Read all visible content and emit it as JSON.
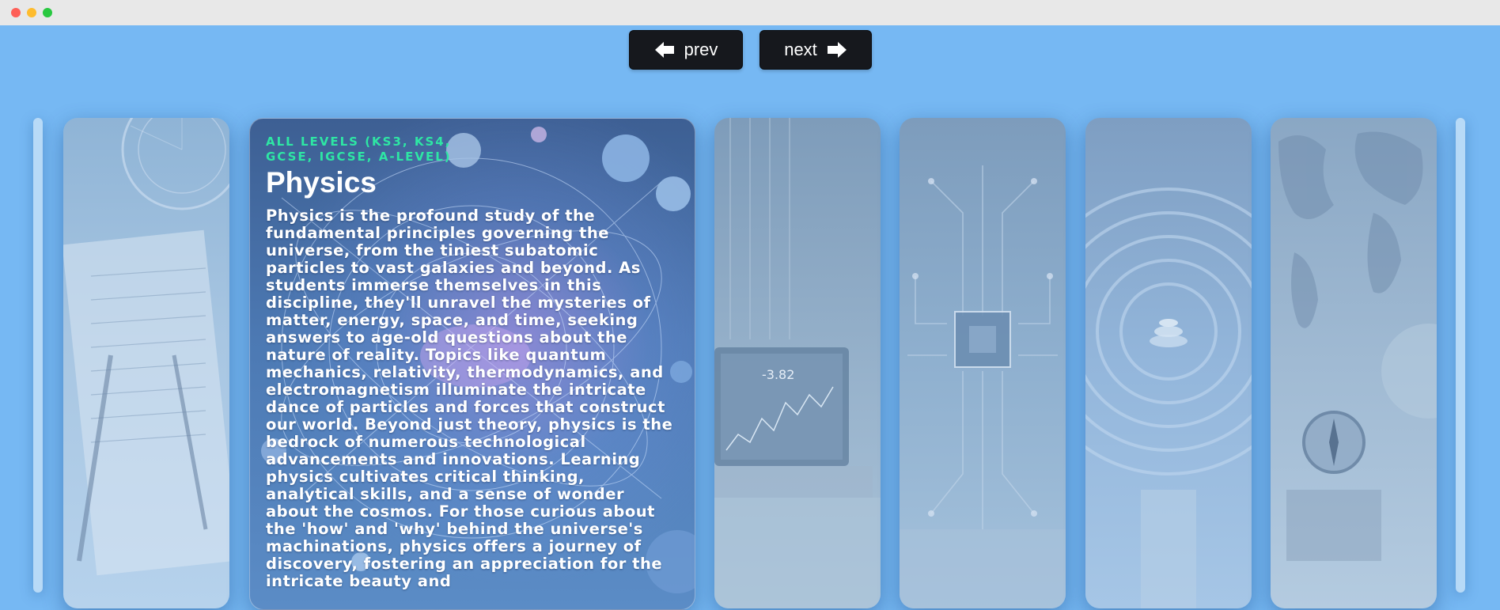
{
  "nav": {
    "prev_label": "prev",
    "next_label": "next"
  },
  "featured_card": {
    "levels": "ALL LEVELS (KS3, KS4, GCSE, IGCSE, A-LEVEL)",
    "title": "Physics",
    "description": "Physics is the profound study of the fundamental principles governing the universe, from the tiniest subatomic particles to vast galaxies and beyond. As students immerse themselves in this discipline, they'll unravel the mysteries of matter, energy, space, and time, seeking answers to age-old questions about the nature of reality. Topics like quantum mechanics, relativity, thermodynamics, and electromagnetism illuminate the intricate dance of particles and forces that construct our world. Beyond just theory, physics is the bedrock of numerous technological advancements and innovations. Learning physics cultivates critical thinking, analytical skills, and a sense of wonder about the cosmos. For those curious about the 'how' and 'why' behind the universe's machinations, physics offers a journey of discovery, fostering an appreciation for the intricate beauty and"
  },
  "side_cards": [
    {
      "theme": "mathematics-notebook"
    },
    {
      "theme": "laptop-stock-chart",
      "chart_readout": "-3.82"
    },
    {
      "theme": "circuit-board"
    },
    {
      "theme": "maze-zen-stones"
    },
    {
      "theme": "world-map-compass"
    }
  ],
  "colors": {
    "background": "#76b8f3",
    "button": "#16181d",
    "accent_levels": "#2ee6a4"
  }
}
